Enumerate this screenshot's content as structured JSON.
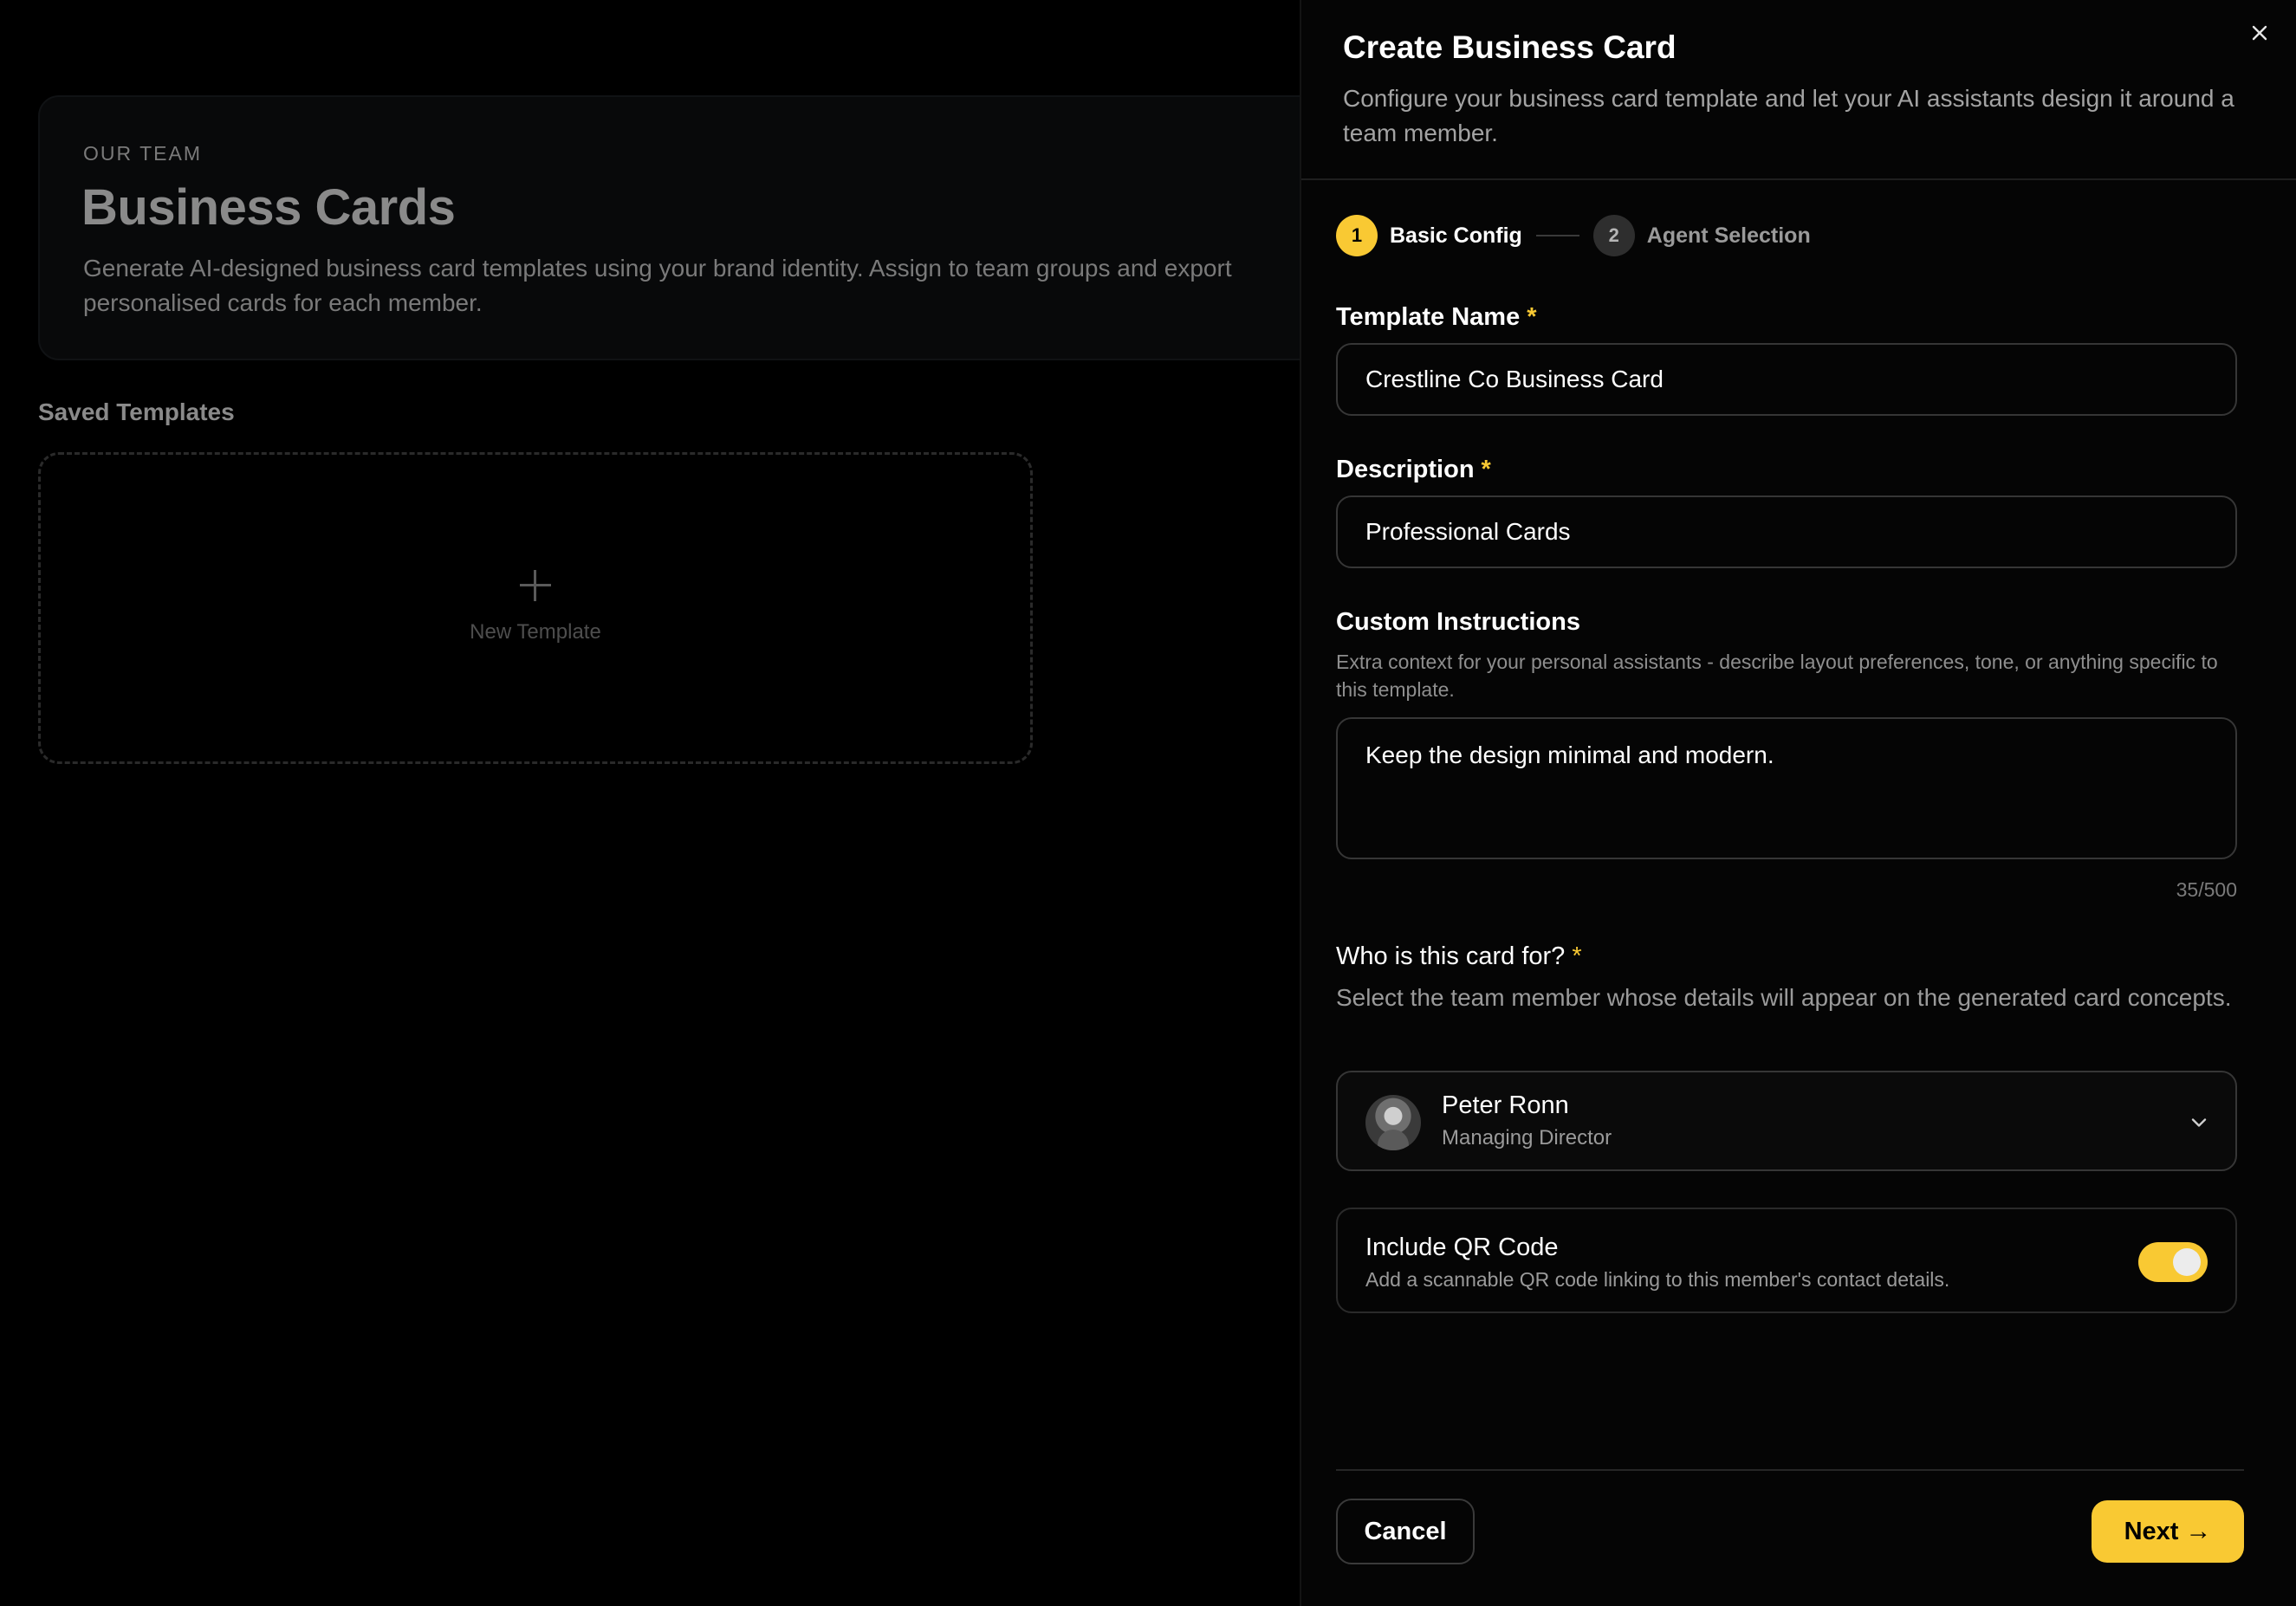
{
  "background": {
    "eyebrow": "OUR TEAM",
    "title": "Business Cards",
    "description": "Generate AI-designed business card templates using your brand identity. Assign to team groups and export personalised cards for each member.",
    "saved_templates_title": "Saved Templates",
    "new_template_label": "New Template",
    "new_template_icon": "plus-icon"
  },
  "drawer": {
    "title": "Create Business Card",
    "subtitle": "Configure your business card template and let your AI assistants design it around a team member.",
    "close_icon": "close-icon",
    "steps": [
      {
        "number": "1",
        "label": "Basic Config",
        "state": "active"
      },
      {
        "number": "2",
        "label": "Agent Selection",
        "state": "inactive"
      }
    ],
    "fields": {
      "template_name": {
        "label": "Template Name",
        "required": "*",
        "value": "Crestline Co Business Card"
      },
      "description": {
        "label": "Description",
        "required": "*",
        "value": "Professional Cards"
      },
      "custom_instructions": {
        "label": "Custom Instructions",
        "help": "Extra context for your personal assistants - describe layout preferences, tone, or anything specific to this template.",
        "value": "Keep the design minimal and modern.",
        "counter": "35/500"
      },
      "card_for": {
        "label": "Who is this card for?",
        "required": "*",
        "help": "Select the team member whose details will appear on the generated card concepts.",
        "selected_name": "Peter Ronn",
        "selected_role": "Managing Director",
        "icon": "chevron-down-icon"
      },
      "qr_code": {
        "title": "Include QR Code",
        "description": "Add a scannable QR code linking to this member's contact details.",
        "enabled": true
      }
    },
    "footer": {
      "cancel_label": "Cancel",
      "next_label": "Next",
      "next_icon": "→"
    }
  },
  "colors": {
    "accent": "#f9c933",
    "background": "#000000",
    "panel": "#050505",
    "border": "#363636"
  }
}
